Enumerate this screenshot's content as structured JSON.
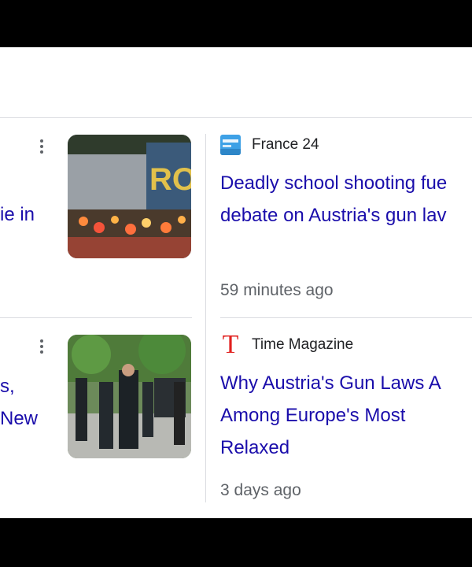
{
  "cards_left": {
    "top_fragment": "ie in",
    "bottom_fragment_1": "s,",
    "bottom_fragment_2": "New"
  },
  "cards_right": [
    {
      "source": "France 24",
      "source_logo_text": "FRANCE 24",
      "headline_line1": "Deadly school shooting fue",
      "headline_line2": "debate on Austria's gun lav",
      "time": "59 minutes ago"
    },
    {
      "source": "Time Magazine",
      "source_logo_text": "T",
      "headline_line1": "Why Austria's Gun Laws A",
      "headline_line2": "Among Europe's Most",
      "headline_line3": "Relaxed",
      "time": "3 days ago"
    }
  ],
  "colors": {
    "headline": "#1a0dab",
    "meta": "#5f6368",
    "france24": "#3ea1e6",
    "time": "#e1211f"
  }
}
